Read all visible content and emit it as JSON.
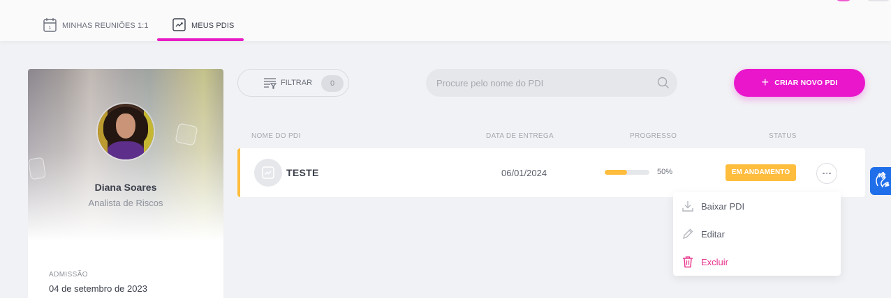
{
  "tabs": [
    {
      "label": "MINHAS REUNIÕES 1:1",
      "icon": "calendar-icon",
      "active": false
    },
    {
      "label": "MEUS PDIS",
      "icon": "chart-icon",
      "active": true
    }
  ],
  "profile": {
    "name": "Diana Soares",
    "role": "Analista de Riscos",
    "admission_label": "ADMISSÃO",
    "admission_date": "04 de setembro de 2023"
  },
  "toolbar": {
    "filter_label": "FILTRAR",
    "filter_count": "0",
    "search_placeholder": "Procure pelo nome do PDI",
    "create_label": "CRIAR NOVO PDI"
  },
  "table": {
    "headers": [
      "NOME DO PDI",
      "DATA DE ENTREGA",
      "PROGRESSO",
      "STATUS"
    ],
    "rows": [
      {
        "name": "TESTE",
        "date": "06/01/2024",
        "progress": 0.5,
        "progress_label": "50%",
        "status": "EM ANDAMENTO"
      }
    ]
  },
  "menu": {
    "download": "Baixar PDI",
    "edit": "Editar",
    "delete": "Excluir"
  },
  "colors": {
    "accent": "#ea16cc",
    "status": "#ffbd3e",
    "delete": "#e8318a",
    "accessibility": "#1f6fea"
  }
}
